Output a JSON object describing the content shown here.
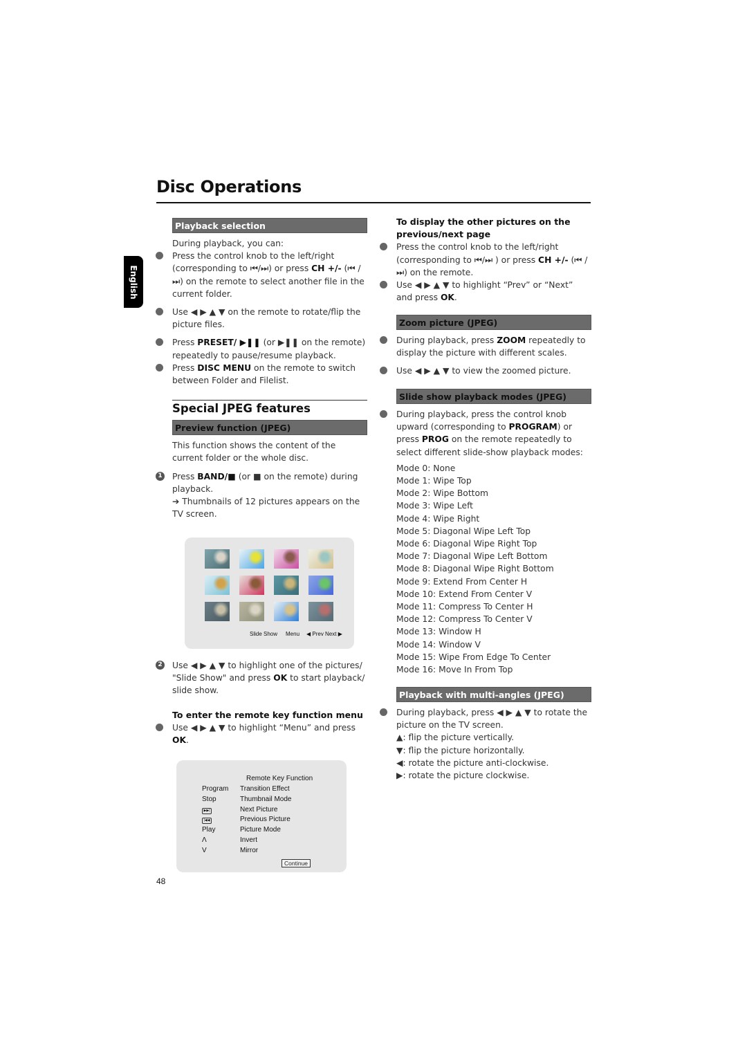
{
  "page": {
    "title": "Disc Operations",
    "language_tab": "English",
    "page_number": "48"
  },
  "left": {
    "playback_selection": {
      "header": "Playback selection",
      "intro": "During playback, you can:",
      "items": [
        {
          "pre": "Press the control knob to the left/right (corresponding to ⏮/⏭) or press ",
          "bold": "CH +/-",
          "post": " (⏮ / ⏭)  on the remote to select another file in the current folder."
        },
        {
          "pre": "Use ◀ ▶ ▲ ▼  on the remote to rotate/flip the picture files.",
          "bold": "",
          "post": ""
        },
        {
          "pre": "Press ",
          "bold": "PRESET/ ▶❚❚",
          "post": "  (or  ▶❚❚  on the remote) repeatedly to pause/resume playback."
        },
        {
          "pre": "Press ",
          "bold": "DISC MENU",
          "post": " on the remote to switch between Folder and Filelist."
        }
      ]
    },
    "special_jpeg": {
      "title": "Special JPEG features",
      "preview_header": "Preview function (JPEG)",
      "preview_intro": "This function shows the content of the current folder or the whole disc.",
      "step1": {
        "num": "1",
        "pre": "Press ",
        "bold": "BAND/■",
        "post": " (or ■  on the remote) during playback."
      },
      "step1_result": "➔ Thumbnails of 12 pictures appears on the TV screen.",
      "step2": {
        "num": "2",
        "pre": "Use ◀ ▶ ▲ ▼  to highlight one of the pictures/ \"Slide Show\" and press ",
        "bold": "OK",
        "post": " to start playback/ slide show."
      },
      "remote_menu_heading": "To enter the remote key function menu",
      "remote_menu_item": {
        "pre": "Use ◀ ▶ ▲ ▼  to highlight “Menu” and press ",
        "bold": "OK",
        "post": "."
      }
    },
    "thumbnail_screen": {
      "thumbnails": [
        {
          "name": "jewelry-rings",
          "colors": [
            "#7fa4ab",
            "#4f6d73",
            "#d9d4c9"
          ]
        },
        {
          "name": "blue-yellow-flower",
          "colors": [
            "#e8f3f8",
            "#4aa6e6",
            "#e6e23c"
          ]
        },
        {
          "name": "pink-ribbon",
          "colors": [
            "#f3d9ea",
            "#c94fa2",
            "#8a5a4f"
          ]
        },
        {
          "name": "gold-necklace",
          "colors": [
            "#eef0e6",
            "#d6c08a",
            "#9bc6c2"
          ]
        },
        {
          "name": "colorful-beads",
          "colors": [
            "#d9eef5",
            "#7cc0d6",
            "#d2a24a"
          ]
        },
        {
          "name": "red-flowers",
          "colors": [
            "#e8e0da",
            "#d0325e",
            "#8a5a3a"
          ]
        },
        {
          "name": "teal-chain",
          "colors": [
            "#5c97a2",
            "#3b6d78",
            "#c9b47a"
          ]
        },
        {
          "name": "blue-sky-pearls",
          "colors": [
            "#8ca6e6",
            "#4667d9",
            "#6cc46a"
          ]
        },
        {
          "name": "dark-pendants",
          "colors": [
            "#6b7d86",
            "#4a5a62",
            "#c7c0a8"
          ]
        },
        {
          "name": "sandy-texture",
          "colors": [
            "#b9b59f",
            "#8f927c",
            "#d9d4c4"
          ]
        },
        {
          "name": "blue-figure",
          "colors": [
            "#e8f1f6",
            "#2e7fd9",
            "#d6c28a"
          ]
        },
        {
          "name": "grey-earrings",
          "colors": [
            "#7c929c",
            "#556a74",
            "#b66f6f"
          ]
        }
      ],
      "buttons": [
        "Slide Show",
        "Menu",
        "Prev",
        "Next"
      ]
    },
    "remote_key_screen": {
      "title": "Remote Key Function",
      "rows": [
        {
          "key": "Program",
          "function": "Transition Effect"
        },
        {
          "key": "Stop",
          "function": "Thumbnail Mode"
        },
        {
          "key": "next-icon",
          "function": "Next Picture"
        },
        {
          "key": "previous-icon",
          "function": "Previous Picture"
        },
        {
          "key": "Play",
          "function": "Picture Mode"
        },
        {
          "key": "Λ",
          "function": "Invert"
        },
        {
          "key": "V",
          "function": "Mirror"
        }
      ],
      "continue_label": "Continue"
    }
  },
  "right": {
    "prev_next": {
      "heading": "To display the other pictures on the previous/next page",
      "items": [
        {
          "pre": "Press the control knob to the left/right (corresponding to ⏮/⏭ ) or press ",
          "bold": "CH +/-",
          "post": " (⏮ / ⏭)  on the remote."
        },
        {
          "pre": "Use ◀ ▶ ▲ ▼  to highlight “Prev” or “Next” and press ",
          "bold": "OK",
          "post": "."
        }
      ]
    },
    "zoom": {
      "header": "Zoom picture (JPEG)",
      "items": [
        {
          "pre": "During playback, press ",
          "bold": "ZOOM",
          "post": " repeatedly to display the picture with different scales."
        },
        {
          "pre": "Use ◀ ▶ ▲ ▼  to view the zoomed picture.",
          "bold": "",
          "post": ""
        }
      ]
    },
    "slideshow": {
      "header": "Slide show playback modes (JPEG)",
      "intro_pre": "During playback, press the control knob upward (corresponding to ",
      "intro_bold1": "PROGRAM",
      "intro_mid": ") or press ",
      "intro_bold2": "PROG",
      "intro_post": " on the remote repeatedly to select different slide-show playback modes:",
      "modes": [
        "Mode 0: None",
        "Mode 1: Wipe Top",
        "Mode 2: Wipe Bottom",
        "Mode 3: Wipe Left",
        "Mode 4: Wipe Right",
        "Mode 5: Diagonal Wipe Left Top",
        "Mode 6: Diagonal Wipe Right Top",
        "Mode 7: Diagonal Wipe Left Bottom",
        "Mode 8: Diagonal Wipe Right Bottom",
        "Mode 9: Extend From Center H",
        "Mode 10: Extend From Center V",
        "Mode 11: Compress To Center H",
        "Mode 12: Compress To Center V",
        "Mode 13: Window H",
        "Mode 14: Window V",
        "Mode 15: Wipe From Edge To Center",
        "Mode 16: Move In From Top"
      ]
    },
    "multi_angles": {
      "header": "Playback with multi-angles (JPEG)",
      "intro": "During playback, press ◀ ▶ ▲ ▼  to rotate the picture on the TV screen.",
      "details": [
        "▲: flip the picture vertically.",
        "▼:  flip the picture horizontally.",
        "◀: rotate the picture anti-clockwise.",
        "▶: rotate the picture clockwise."
      ]
    }
  }
}
